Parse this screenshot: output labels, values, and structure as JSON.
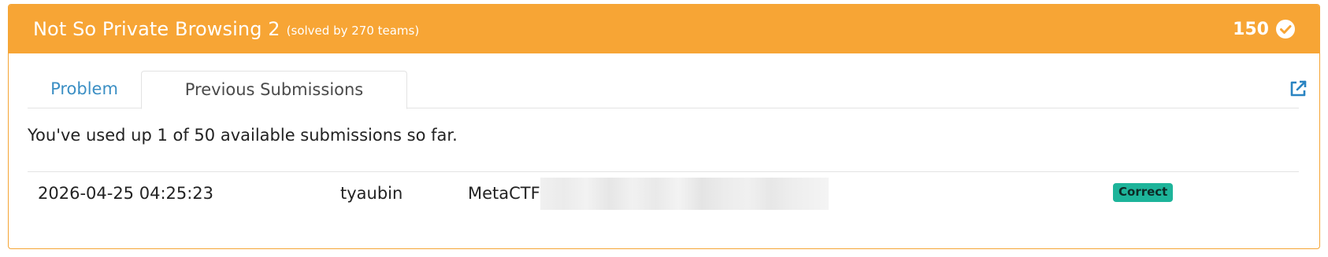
{
  "header": {
    "title": "Not So Private Browsing 2",
    "solved_text": "(solved by 270 teams)",
    "points": "150",
    "check_icon": "check-circle-icon",
    "bg_color": "#f7a535"
  },
  "tabs": [
    {
      "label": "Problem",
      "active": false
    },
    {
      "label": "Previous Submissions",
      "active": true
    }
  ],
  "external_link_icon": "external-link-icon",
  "usage_text": "You've used up 1 of 50 available submissions so far.",
  "submissions": [
    {
      "timestamp": "2026-04-25 04:25:23",
      "user": "tyaubin",
      "flag_prefix": "MetaCTF",
      "status": "Correct",
      "status_color": "#1db49a"
    }
  ]
}
